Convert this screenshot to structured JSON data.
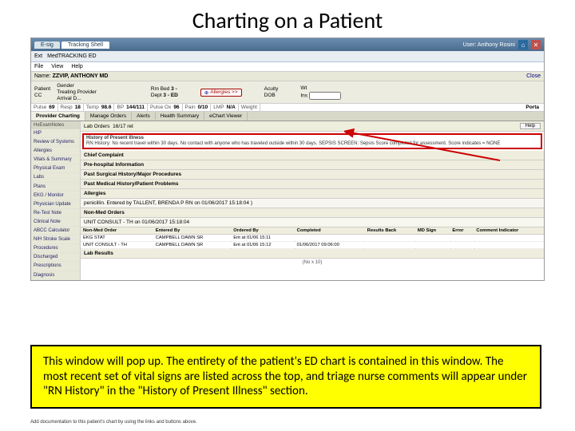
{
  "slide": {
    "title": "Charting on a Patient"
  },
  "titlebar": {
    "tabs": [
      "E-sig",
      "Tracking Shell"
    ],
    "user_label": "User: Anthony Rosini",
    "icons": [
      "home-icon",
      "close-icon"
    ]
  },
  "toolbar2": {
    "items": [
      "Ext",
      "MedTRACKING ED",
      "..."
    ]
  },
  "menubar": {
    "items": [
      "File",
      "View",
      "Help"
    ]
  },
  "patient": {
    "name": "ZZVIP, ANTHONY MD",
    "close_label": "Close"
  },
  "demographics": {
    "col1": [
      {
        "lbl": "Patient",
        "val": ""
      },
      {
        "lbl": "CC",
        "val": ""
      }
    ],
    "col2": [
      {
        "lbl": "Gender",
        "val": ""
      },
      {
        "lbl": "Treating Provider",
        "val": ""
      },
      {
        "lbl": "Arrival D...",
        "val": ""
      }
    ],
    "col3": [
      {
        "lbl": "Rm Bed",
        "val": "3 -"
      },
      {
        "lbl": "Dept",
        "val": "3 - ED"
      }
    ],
    "allergy_btn": "Allergies >>",
    "col4": [
      {
        "lbl": "Acuity",
        "val": ""
      },
      {
        "lbl": "DOB",
        "val": ""
      }
    ],
    "col5": [
      {
        "lbl": "Wt",
        "val": ""
      },
      {
        "lbl": "Ins",
        "val": ""
      }
    ]
  },
  "vitals": [
    {
      "lbl": "Pulse",
      "val": "69"
    },
    {
      "lbl": "Resp",
      "val": "18"
    },
    {
      "lbl": "Temp",
      "val": "98.6"
    },
    {
      "lbl": "BP",
      "val": "144/111"
    },
    {
      "lbl": "Pulse Ox",
      "val": "96"
    },
    {
      "lbl": "Pain",
      "val": "0/10"
    },
    {
      "lbl": "LMP",
      "val": "N/A"
    },
    {
      "lbl": "Weight",
      "val": ""
    }
  ],
  "vitals_porta": "Porta",
  "chart_tabs": [
    "Provider Charting",
    "Manage Orders",
    "Alerts",
    "Health Summary",
    "eChart Viewer"
  ],
  "sidebar_header": "HxExamNotes",
  "sidebar_items": [
    "HIP",
    "Review of Systems",
    "Allergies",
    "Vitals & Summary",
    "Physical Exam",
    "Labs",
    "Plans",
    "EKG / Monitor",
    "Physician Update",
    "Re-Test Note",
    "Clinical Note",
    "ABCC Calculator",
    "NIH Stroke Scale",
    "Procedures",
    "Discharged",
    "Prescriptions",
    "Diagnosis"
  ],
  "orders_row": {
    "label": "Lab Orders",
    "count": "16/17 ret",
    "help": "Help"
  },
  "highlight": {
    "hpi": "History of Present Illness",
    "rnh": "RN History: No recent travel within 30 days. No contact with anyone who has traveled outside within 30 days. SEPSIS SCREEN: Sepsis Score completed for assessment. Score indicates = NONE"
  },
  "sections": {
    "chief": "Chief Complaint",
    "prehosp": "Pre-hospital Information",
    "surg": "Past Surgical History/Major Procedures",
    "pmh": "Past Medical History/Patient Problems",
    "allergies": "Allergies",
    "allergies_sub": "penicillin. Entered by TALLENT, BRENDA P RN on 01/06/2017 15:18:04 )",
    "nonmed": "Non-Med Orders",
    "nonmed_sub": "UNIT CONSULT - TH  on 01/06/2017 15:18:04",
    "labresults": "Lab Results"
  },
  "med_table": {
    "headers": [
      "Non-Med Order",
      "Entered By",
      "Ordered By",
      "Completed",
      "Results Back",
      "MD Sign",
      "Error",
      "Comment Indicator"
    ],
    "rows": [
      {
        "order": "EKG STAT",
        "eby": "CAMPBELL DAWN SR",
        "oby": "Ent at 01/06 15:11",
        "comp": "",
        "rb": "",
        "sign": "",
        "err": "",
        "ci": ""
      },
      {
        "order": "UNIT CONSULT - TH",
        "eby": "CAMPBELL DAWN SR",
        "oby": "Ent at 01/06 15:12",
        "comp": "01/06/2017 09:06:00",
        "rb": "",
        "sign": "",
        "err": "",
        "ci": ""
      }
    ]
  },
  "lab_note": "(No x 10)",
  "caption": "This window will pop up. The entirety of the patient's ED chart is contained in this window. The most recent set of vital signs are listed across the top, and triage nurse comments will appear under \"RN History\" in the \"History of Present Illness\" section.",
  "footer": "Add documentation to this patient's chart by using the links and buttons above."
}
